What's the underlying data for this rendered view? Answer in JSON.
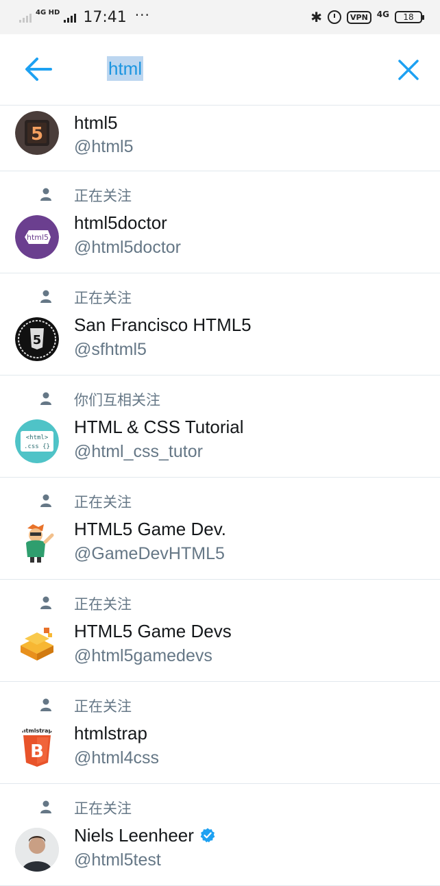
{
  "status_bar": {
    "network_label": "4G HD",
    "time": "17:41",
    "more": "···",
    "vpn": "VPN",
    "net_type": "4G",
    "battery": "18"
  },
  "search": {
    "query": "html"
  },
  "colors": {
    "accent": "#1da1f2",
    "muted_text": "#657786",
    "divider": "#e1e8ed",
    "selection": "#bcd6f0"
  },
  "results": [
    {
      "note": "",
      "name": "html5",
      "handle": "@html5",
      "avatar": "html5-logo-avatar",
      "verified": false
    },
    {
      "note": "正在关注",
      "name": "html5doctor",
      "handle": "@html5doctor",
      "avatar": "html5doctor-avatar",
      "verified": false
    },
    {
      "note": "正在关注",
      "name": "San Francisco HTML5",
      "handle": "@sfhtml5",
      "avatar": "sfhtml5-badge-avatar",
      "verified": false
    },
    {
      "note": "你们互相关注",
      "name": "HTML & CSS Tutorial",
      "handle": "@html_css_tutor",
      "avatar": "html-css-tutor-avatar",
      "verified": false
    },
    {
      "note": "正在关注",
      "name": "HTML5 Game Dev.",
      "handle": "@GameDevHTML5",
      "avatar": "cartoon-mascot-avatar",
      "verified": false
    },
    {
      "note": "正在关注",
      "name": "HTML5 Game Devs",
      "handle": "@html5gamedevs",
      "avatar": "orange-blocks-avatar",
      "verified": false
    },
    {
      "note": "正在关注",
      "name": "htmlstrap",
      "handle": "@html4css",
      "avatar": "htmlstrap-shield-avatar",
      "verified": false
    },
    {
      "note": "正在关注",
      "name": "Niels Leenheer",
      "handle": "@html5test",
      "avatar": "person-photo-avatar",
      "verified": true
    }
  ]
}
